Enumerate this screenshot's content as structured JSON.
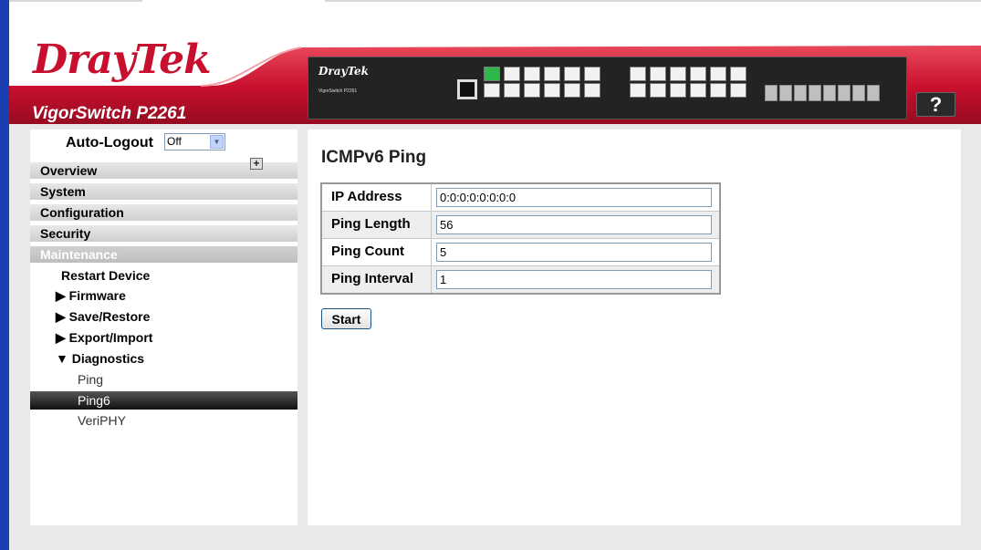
{
  "header": {
    "logo_text": "DrayTek",
    "model_name": "VigorSwitch P2261",
    "device_logo": "DrayTek",
    "device_model_line": "VigorSwitch P2261",
    "help_label": "?",
    "brand_red": "#c8102e"
  },
  "autologout": {
    "label": "Auto-Logout",
    "value": "Off"
  },
  "menu": {
    "overview": "Overview",
    "system": "System",
    "configuration": "Configuration",
    "security": "Security",
    "maintenance": "Maintenance"
  },
  "maintenance": {
    "restart": "Restart Device",
    "firmware": "▶ Firmware",
    "save_restore": "▶ Save/Restore",
    "export_import": "▶ Export/Import",
    "diagnostics": "▼ Diagnostics",
    "diag_items": [
      "Ping",
      "Ping6",
      "VeriPHY"
    ],
    "active_item": "Ping6"
  },
  "main": {
    "title": "ICMPv6 Ping",
    "fields": [
      {
        "label": "IP Address",
        "value": "0:0:0:0:0:0:0:0"
      },
      {
        "label": "Ping Length",
        "value": "56"
      },
      {
        "label": "Ping Count",
        "value": "5"
      },
      {
        "label": "Ping Interval",
        "value": "1"
      }
    ],
    "start_label": "Start"
  }
}
